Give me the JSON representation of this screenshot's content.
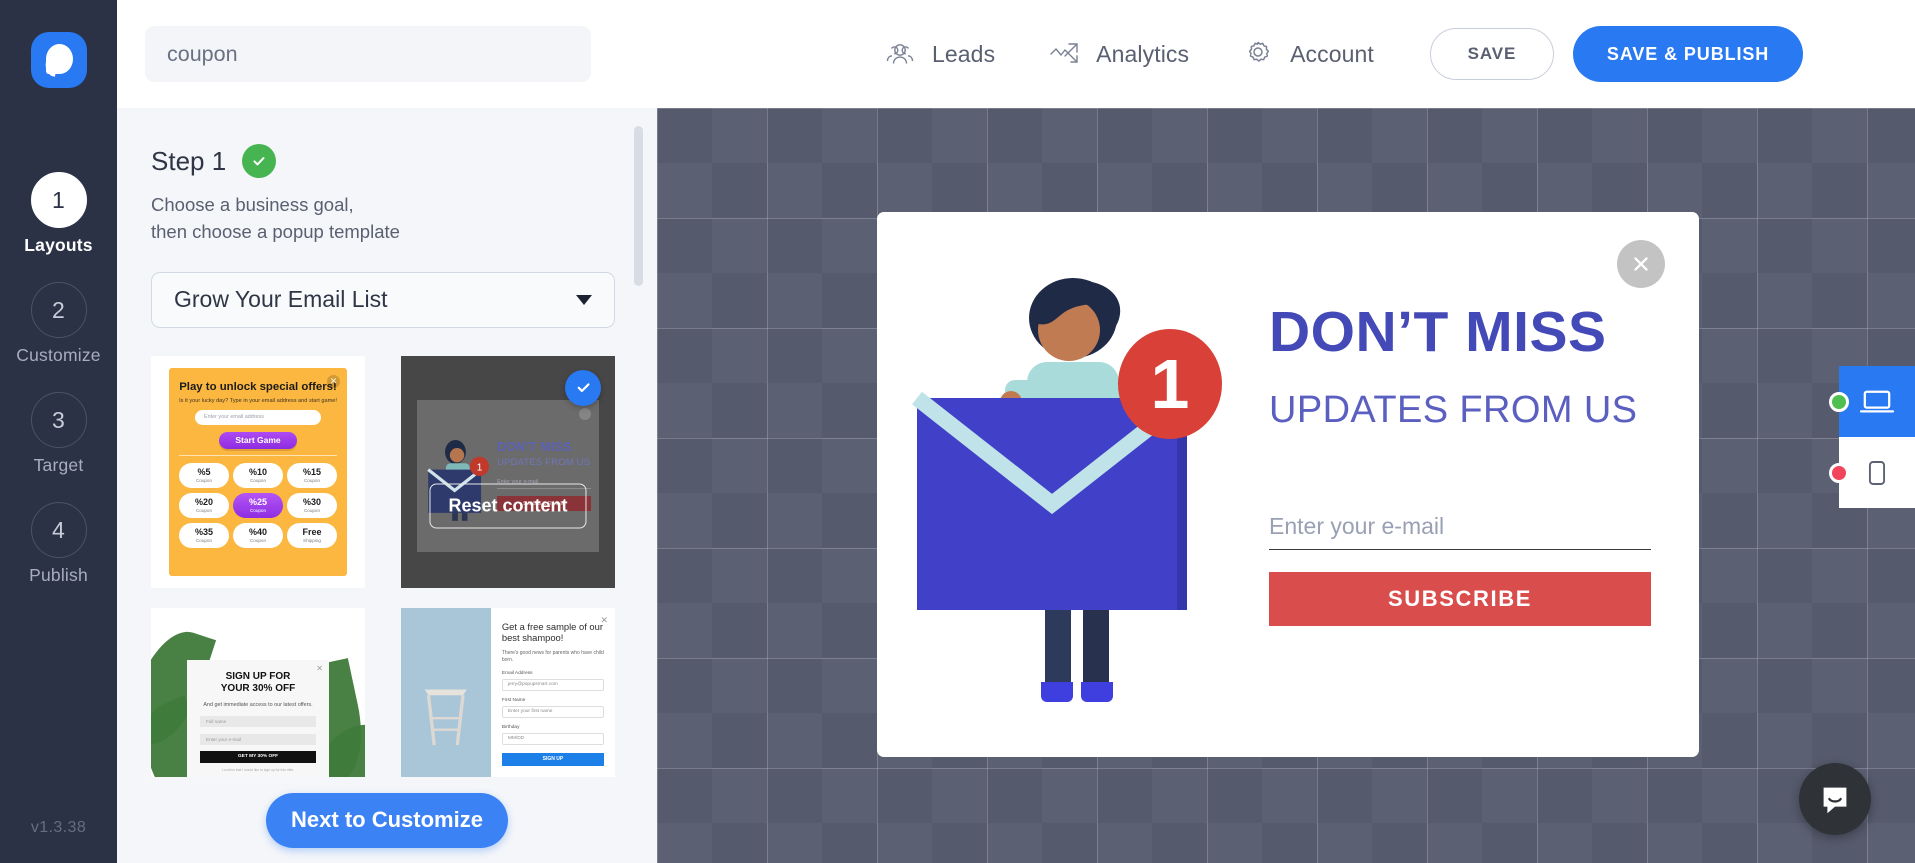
{
  "app": {
    "logo_name": "popupsmart-logo",
    "version": "v1.3.38",
    "accent_blue": "#2979f2",
    "rail_bg": "#2b3246",
    "success_green": "#46b450",
    "danger_red": "#d94d4d"
  },
  "rail": {
    "steps": [
      {
        "num": "1",
        "label": "Layouts",
        "active": true
      },
      {
        "num": "2",
        "label": "Customize",
        "active": false
      },
      {
        "num": "3",
        "label": "Target",
        "active": false
      },
      {
        "num": "4",
        "label": "Publish",
        "active": false
      }
    ]
  },
  "topbar": {
    "search": {
      "value": "coupon",
      "placeholder": "coupon"
    },
    "nav": [
      {
        "label": "Leads",
        "icon": "users-icon"
      },
      {
        "label": "Analytics",
        "icon": "analytics-chart-icon"
      },
      {
        "label": "Account",
        "icon": "gear-icon"
      }
    ],
    "save_label": "SAVE",
    "publish_label": "SAVE & PUBLISH"
  },
  "panel": {
    "step_title": "Step 1",
    "step_desc_line1": "Choose a business goal,",
    "step_desc_line2": "then choose a popup template",
    "goal_selected": "Grow Your Email List",
    "reset_label": "Reset content",
    "next_label": "Next to Customize",
    "templates": [
      {
        "name": "play-to-unlock-coupon-game",
        "selected": false,
        "heading": "Play to unlock special offers!",
        "subheading": "Is it your lucky day? Type in your email address and start game!",
        "input_placeholder": "Enter your email address",
        "button": "Start Game",
        "coupons": [
          {
            "amount": "%5",
            "label": "Coupon",
            "highlight": false
          },
          {
            "amount": "%10",
            "label": "Coupon",
            "highlight": false
          },
          {
            "amount": "%15",
            "label": "Coupon",
            "highlight": false
          },
          {
            "amount": "%20",
            "label": "Coupon",
            "highlight": false
          },
          {
            "amount": "%25",
            "label": "Coupon",
            "highlight": true
          },
          {
            "amount": "%30",
            "label": "Coupon",
            "highlight": false
          },
          {
            "amount": "%35",
            "label": "Coupon",
            "highlight": false
          },
          {
            "amount": "%40",
            "label": "Coupon",
            "highlight": false
          },
          {
            "amount": "Free",
            "label": "Shipping",
            "highlight": false
          }
        ]
      },
      {
        "name": "dont-miss-updates",
        "selected": true,
        "heading": "DON'T MISS",
        "subheading": "UPDATES FROM US",
        "input_placeholder": "Enter your e-mail",
        "button": "SUBSCRIBE"
      },
      {
        "name": "sign-up-30-percent-off",
        "selected": false,
        "heading_line1": "SIGN UP FOR",
        "heading_line2": "YOUR 30% OFF",
        "subheading": "And get immediate access to our latest offers.",
        "field_name": "Full name",
        "field_email": "Enter your e-mail",
        "button": "GET MY 30% OFF",
        "note": "I confirm that I would like to sign up for this offer."
      },
      {
        "name": "free-sample-shampoo",
        "selected": false,
        "heading": "Get a free sample of our best shampoo!",
        "subheading": "There's good news for parents who have child born.",
        "label_email": "Email Address",
        "value_email": "jerry@popupsmart.com",
        "label_first_name": "First Name",
        "placeholder_first_name": "Enter your first name",
        "label_birthday": "Birthday",
        "placeholder_birthday": "MM/DD",
        "button": "SIGN UP"
      }
    ]
  },
  "preview": {
    "heading": "DON’T MISS",
    "subheading": "UPDATES FROM US",
    "email_placeholder": "Enter your e-mail",
    "email_value": "",
    "subscribe_label": "SUBSCRIBE",
    "close_icon": "close-icon",
    "illustration": "woman-holding-envelope-with-notification-badge",
    "notification_count": "1"
  },
  "device_switch": {
    "options": [
      {
        "name": "desktop",
        "icon": "laptop-icon",
        "selected": true,
        "status_color": "#4fc04f"
      },
      {
        "name": "mobile",
        "icon": "phone-icon",
        "selected": false,
        "status_color": "#f2445c"
      }
    ]
  },
  "chat": {
    "icon": "intercom-chat-icon"
  }
}
